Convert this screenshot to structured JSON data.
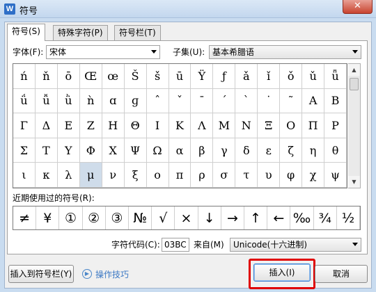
{
  "window": {
    "title": "符号",
    "app_icon_letter": "W",
    "close_glyph": "✕"
  },
  "tabs": [
    {
      "label": "符号(S)"
    },
    {
      "label": "特殊字符(P)"
    },
    {
      "label": "符号栏(T)"
    }
  ],
  "font": {
    "label": "字体(F):",
    "value": "宋体"
  },
  "subset": {
    "label": "子集(U):",
    "value": "基本希腊语"
  },
  "symbols": [
    [
      "ń",
      "ň",
      "ō",
      "Œ",
      "œ",
      "Š",
      "š",
      "ū",
      "Ÿ",
      "ƒ",
      "ǎ",
      "ǐ",
      "ǒ",
      "ǔ",
      "ǖ"
    ],
    [
      "ǘ",
      "ǚ",
      "ǜ",
      "ǹ",
      "ɑ",
      "ɡ",
      "ˆ",
      "ˇ",
      "ˉ",
      "ˊ",
      "ˋ",
      "˙",
      "˜",
      "Α",
      "Β"
    ],
    [
      "Γ",
      "Δ",
      "Ε",
      "Ζ",
      "Η",
      "Θ",
      "Ι",
      "Κ",
      "Λ",
      "Μ",
      "Ν",
      "Ξ",
      "Ο",
      "Π",
      "Ρ"
    ],
    [
      "Σ",
      "Τ",
      "Υ",
      "Φ",
      "Χ",
      "Ψ",
      "Ω",
      "α",
      "β",
      "γ",
      "δ",
      "ε",
      "ζ",
      "η",
      "θ"
    ],
    [
      "ι",
      "κ",
      "λ",
      "μ",
      "ν",
      "ξ",
      "ο",
      "π",
      "ρ",
      "σ",
      "τ",
      "υ",
      "φ",
      "χ",
      "ψ"
    ]
  ],
  "selected_symbol": "μ",
  "recent": {
    "label": "近期使用过的符号(R):",
    "symbols": [
      "≠",
      "¥",
      "①",
      "②",
      "③",
      "№",
      "√",
      "×",
      "↓",
      "→",
      "↑",
      "←",
      "‰",
      "¾",
      "½"
    ]
  },
  "char_code": {
    "label": "字符代码(C):",
    "value": "03BC"
  },
  "from": {
    "label": "来自(M)",
    "value": "Unicode(十六进制)"
  },
  "buttons": {
    "insert_to_bar": "插入到符号栏(Y)",
    "tips": "操作技巧",
    "insert": "插入(I)",
    "cancel": "取消"
  }
}
